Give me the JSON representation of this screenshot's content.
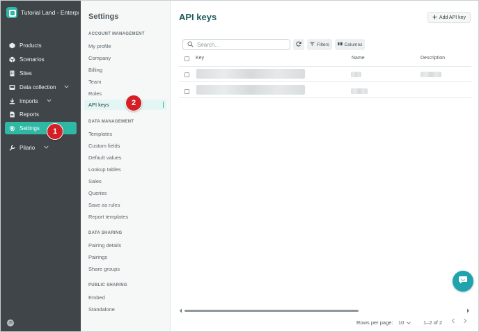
{
  "app": {
    "tenant_name": "Tutorial Land - Enterpris"
  },
  "nav": {
    "items": [
      {
        "label": "Products",
        "icon": "box-icon"
      },
      {
        "label": "Scenarios",
        "icon": "cube-icon"
      },
      {
        "label": "Sites",
        "icon": "building-icon"
      },
      {
        "label": "Data collection",
        "icon": "inbox-icon"
      },
      {
        "label": "Imports",
        "icon": "download-icon"
      },
      {
        "label": "Reports",
        "icon": "document-icon"
      },
      {
        "label": "Settings",
        "icon": "gear-icon"
      },
      {
        "label": "Pilario",
        "icon": "wrench-icon"
      }
    ],
    "active": "Settings",
    "avatar_initials": "JB"
  },
  "settings": {
    "title": "Settings",
    "sections": [
      {
        "heading": "ACCOUNT MANAGEMENT",
        "items": [
          "My profile",
          "Company",
          "Billing",
          "Team",
          "Roles",
          "API keys"
        ]
      },
      {
        "heading": "DATA MANAGEMENT",
        "items": [
          "Templates",
          "Custom fields",
          "Default values",
          "Lookup tables",
          "Sales",
          "Queries",
          "Save as rules",
          "Report templates"
        ]
      },
      {
        "heading": "DATA SHARING",
        "items": [
          "Pairing details",
          "Pairings",
          "Share groups"
        ]
      },
      {
        "heading": "PUBLIC SHARING",
        "items": [
          "Embed",
          "Standalone"
        ]
      }
    ],
    "active_item": "API keys"
  },
  "badges": {
    "step1": "1",
    "step2": "2"
  },
  "main": {
    "title": "API keys",
    "add_button": "Add API key",
    "search_placeholder": "Search...",
    "filters_label": "Filters",
    "columns_label": "Columns",
    "table": {
      "headers": [
        "Key",
        "Name",
        "Description"
      ],
      "row_count_visible": 2
    },
    "footer": {
      "rows_per_page_label": "Rows per page:",
      "rows_per_page_value": "10",
      "range": "1–2 of 2"
    }
  },
  "colors": {
    "sidebar_bg": "#3f4549",
    "accent": "#2fb8a4",
    "title_color": "#1f5c5c",
    "badge_red": "#d41f26",
    "chat_bubble": "#1fa4ad"
  }
}
